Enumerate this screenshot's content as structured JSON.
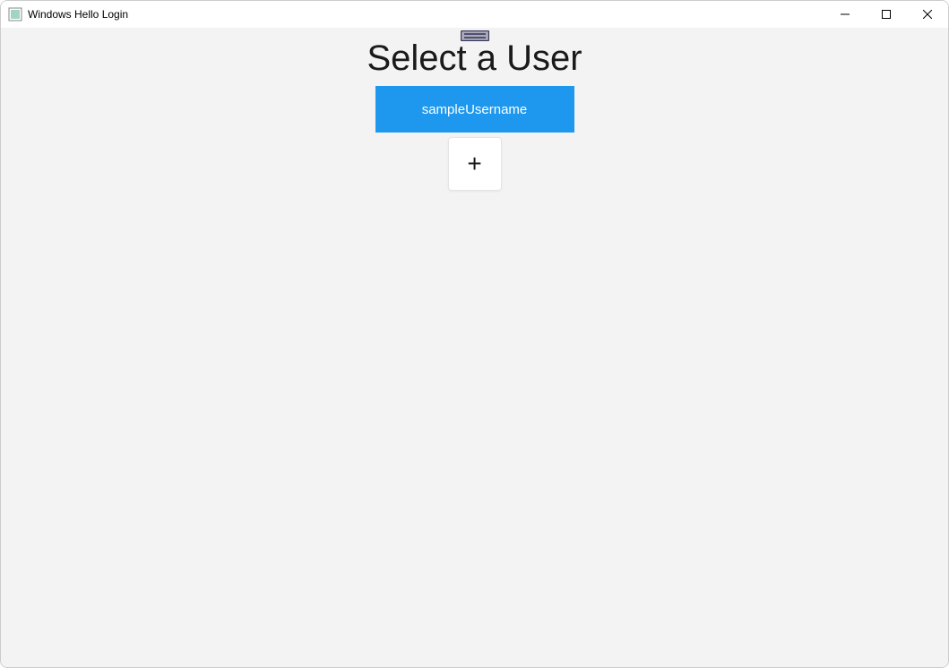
{
  "window": {
    "title": "Windows Hello Login"
  },
  "main": {
    "heading": "Select a User",
    "users": [
      {
        "label": "sampleUsername"
      }
    ],
    "add_label": "+"
  },
  "colors": {
    "accent": "#1e98ef",
    "background": "#f3f3f3"
  }
}
